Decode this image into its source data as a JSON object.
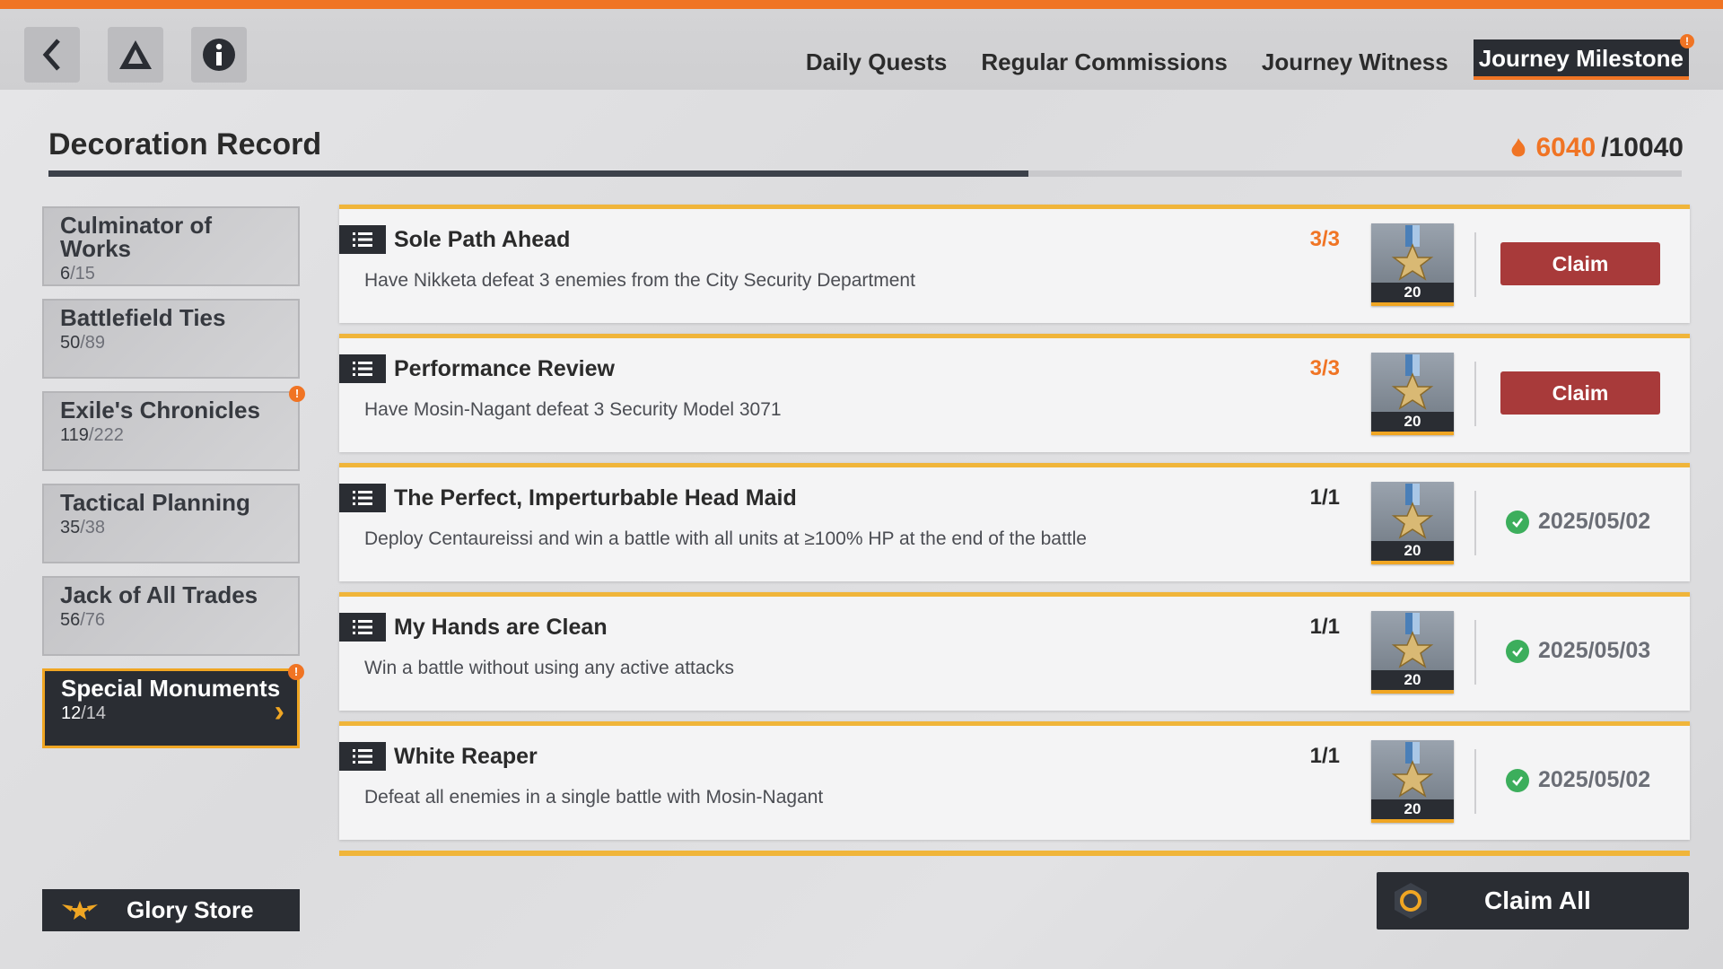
{
  "topbar": {
    "tabs": [
      {
        "label": "Daily Quests",
        "active": false
      },
      {
        "label": "Regular Commissions",
        "active": false
      },
      {
        "label": "Journey Witness",
        "active": false
      },
      {
        "label": "Journey Milestone",
        "active": true,
        "alert": "!"
      }
    ]
  },
  "header": {
    "title": "Decoration Record",
    "score_current": "6040",
    "score_max": "/10040",
    "progress_fraction": 0.6
  },
  "sidebar": {
    "items": [
      {
        "name": "Culminator of Works",
        "done": "6",
        "total": "/15",
        "active": false,
        "alert": ""
      },
      {
        "name": "Battlefield Ties",
        "done": "50",
        "total": "/89",
        "active": false,
        "alert": ""
      },
      {
        "name": "Exile's Chronicles",
        "done": "119",
        "total": "/222",
        "active": false,
        "alert": "!"
      },
      {
        "name": "Tactical Planning",
        "done": "35",
        "total": "/38",
        "active": false,
        "alert": ""
      },
      {
        "name": "Jack of All Trades",
        "done": "56",
        "total": "/76",
        "active": false,
        "alert": ""
      },
      {
        "name": "Special Monuments",
        "done": "12",
        "total": "/14",
        "active": true,
        "alert": "!"
      }
    ],
    "glory_store_label": "Glory Store"
  },
  "quests": [
    {
      "title": "Sole Path Ahead",
      "desc": "Have Nikketa defeat 3 enemies from the City Security Department",
      "progress": "3/3",
      "reward": "20",
      "status": "claim",
      "action_label": "Claim"
    },
    {
      "title": "Performance Review",
      "desc": "Have Mosin-Nagant defeat 3 Security Model 3071",
      "progress": "3/3",
      "reward": "20",
      "status": "claim",
      "action_label": "Claim"
    },
    {
      "title": "The Perfect, Imperturbable Head Maid",
      "desc": "Deploy Centaureissi and win a battle with all units at ≥100% HP at the end of the battle",
      "progress": "1/1",
      "reward": "20",
      "status": "done",
      "date": "2025/05/02"
    },
    {
      "title": "My Hands are Clean",
      "desc": "Win a battle without using any active attacks",
      "progress": "1/1",
      "reward": "20",
      "status": "done",
      "date": "2025/05/03"
    },
    {
      "title": "White Reaper",
      "desc": "Defeat all enemies in a single battle with Mosin-Nagant",
      "progress": "1/1",
      "reward": "20",
      "status": "done",
      "date": "2025/05/02"
    }
  ],
  "claim_all_label": "Claim All",
  "colors": {
    "accent": "#f07424",
    "gold": "#f0b53a",
    "claim": "#a83a3a",
    "dark": "#2a2d33",
    "success": "#3cae5c"
  }
}
